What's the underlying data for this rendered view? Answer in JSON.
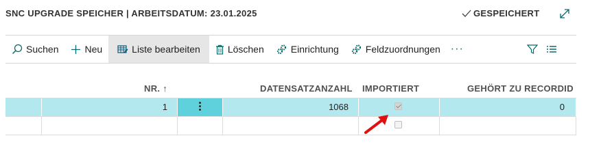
{
  "header": {
    "title": "SNC UPGRADE SPEICHER | ARBEITSDATUM: 23.01.2025",
    "saved_status": "GESPEICHERT"
  },
  "toolbar": {
    "search": "Suchen",
    "new": "Neu",
    "edit_list": "Liste bearbeiten",
    "delete": "Löschen",
    "setup": "Einrichtung",
    "field_mapping": "Feldzuordnungen",
    "more": "···"
  },
  "columns": {
    "nr": "NR. ↑",
    "record_count": "DATENSATZANZAHL",
    "imported": "IMPORTIERT",
    "belongs_to": "GEHÖRT ZU RECORDID"
  },
  "rows": [
    {
      "nr": "1",
      "record_count": "1068",
      "imported": true,
      "belongs_to": "0"
    },
    {
      "nr": "",
      "record_count": "",
      "imported": false,
      "belongs_to": ""
    }
  ],
  "colors": {
    "selected_row": "#b3e8ef",
    "selected_cell": "#5fd1dc",
    "accent": "#0b6a6a",
    "annotation_arrow": "#e01010"
  }
}
